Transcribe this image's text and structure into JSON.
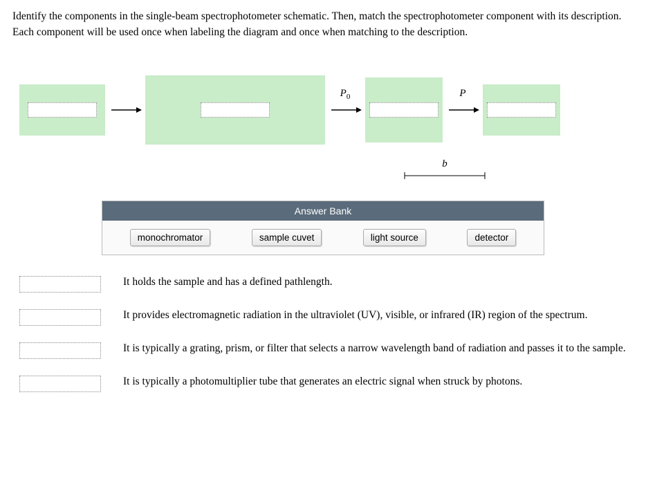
{
  "instructions": "Identify the components in the single-beam spectrophotometer schematic. Then, match the spectrophotometer component with its description. Each component will be used once when labeling the diagram and once when matching to the description.",
  "labels": {
    "p0": "P",
    "p0_sub": "0",
    "p": "P",
    "b": "b"
  },
  "answer_bank": {
    "header": "Answer Bank",
    "items": [
      "monochromator",
      "sample cuvet",
      "light source",
      "detector"
    ]
  },
  "descriptions": [
    "It holds the sample and has a defined pathlength.",
    "It provides electromagnetic radiation in the ultraviolet (UV), visible, or infrared (IR) region of the spectrum.",
    "It is typically a grating, prism, or filter that selects a narrow wavelength band of radiation and passes it to the sample.",
    "It is typically a photomultiplier tube that generates an electric signal when struck by photons."
  ]
}
